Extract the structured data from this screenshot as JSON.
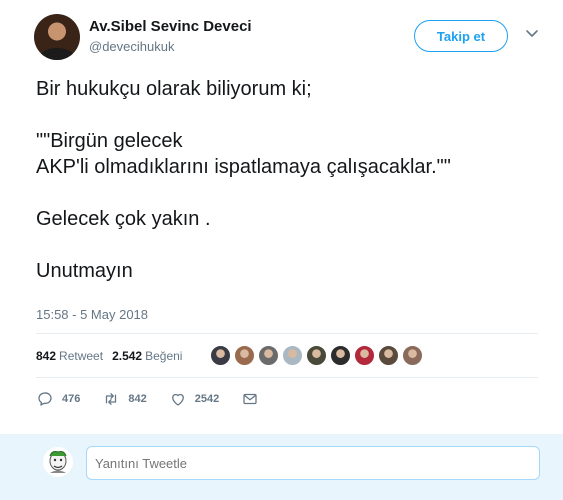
{
  "author": {
    "name": "Av.Sibel Sevinc Deveci",
    "handle": "@devecihukuk"
  },
  "follow_button_label": "Takip et",
  "tweet": {
    "lines": [
      "Bir hukukçu olarak biliyorum ki;",
      "\"\"Birgün gelecek",
      "AKP'li olmadıklarını ispatlamaya çalışacaklar.\"\"",
      "Gelecek çok yakın .",
      "Unutmayın"
    ],
    "timestamp": "15:58 - 5 May 2018"
  },
  "stats": {
    "retweet_count": "842",
    "retweet_label": "Retweet",
    "like_count": "2.542",
    "like_label": "Beğeni"
  },
  "liker_colors": [
    "#3b3b46",
    "#9a6a4f",
    "#6b6b6b",
    "#aab8c2",
    "#4a4a3a",
    "#2c2c2c",
    "#b3283a",
    "#5a4a3c",
    "#8a6a5a"
  ],
  "actions": {
    "reply_count": "476",
    "retweet_count": "842",
    "like_count": "2542"
  },
  "icons": {
    "caret": "chevron-down-icon",
    "reply": "reply-icon",
    "retweet": "retweet-icon",
    "like": "heart-icon",
    "dm": "mail-icon"
  },
  "reply_placeholder": "Yanıtını Tweetle",
  "colors": {
    "accent": "#1da1f2",
    "secondary_text": "#657786",
    "reply_bar_bg": "#e8f5fd"
  }
}
